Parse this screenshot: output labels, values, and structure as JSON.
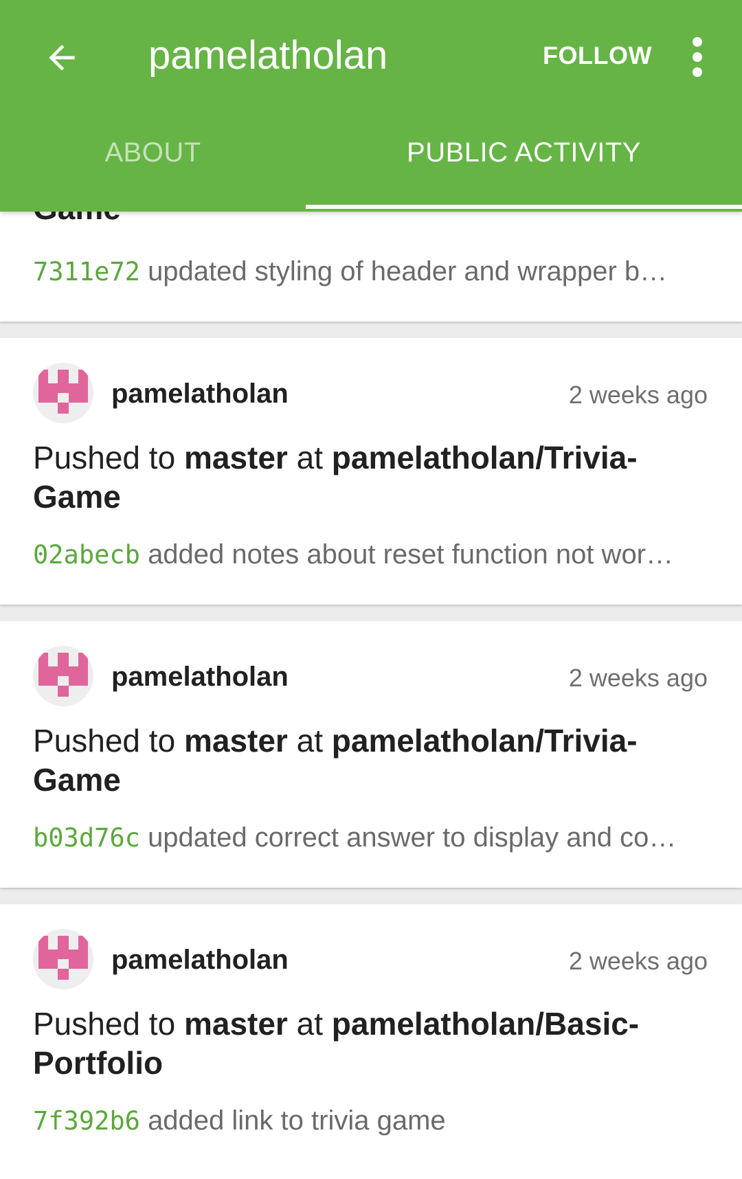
{
  "appbar": {
    "title": "pamelatholan",
    "follow_label": "FOLLOW",
    "color": "#66b446"
  },
  "tabs": [
    {
      "label": "ABOUT",
      "selected": false
    },
    {
      "label": "PUBLIC ACTIVITY",
      "selected": true
    }
  ],
  "icons": {
    "back": "arrow-back-icon",
    "menu": "more-vert-icon",
    "avatar": "identicon"
  },
  "partial_card": {
    "repo_tail": "Game",
    "sha": "7311e72",
    "message": "updated styling of header and wrapper b…"
  },
  "events": [
    {
      "user": "pamelatholan",
      "time": "2 weeks ago",
      "action": "Pushed to",
      "branch": "master",
      "at": "at",
      "repo": "pamelatholan/Trivia-Game",
      "sha": "02abecb",
      "message": "added notes about reset function not wor…"
    },
    {
      "user": "pamelatholan",
      "time": "2 weeks ago",
      "action": "Pushed to",
      "branch": "master",
      "at": "at",
      "repo": "pamelatholan/Trivia-Game",
      "sha": "b03d76c",
      "message": "updated correct answer to display and co…"
    },
    {
      "user": "pamelatholan",
      "time": "2 weeks ago",
      "action": "Pushed to",
      "branch": "master",
      "at": "at",
      "repo": "pamelatholan/Basic-Portfolio",
      "sha": "7f392b6",
      "message": "added link to trivia game"
    }
  ],
  "colors": {
    "sha": "#5aa83c",
    "avatar_pink": "#e0659b"
  }
}
